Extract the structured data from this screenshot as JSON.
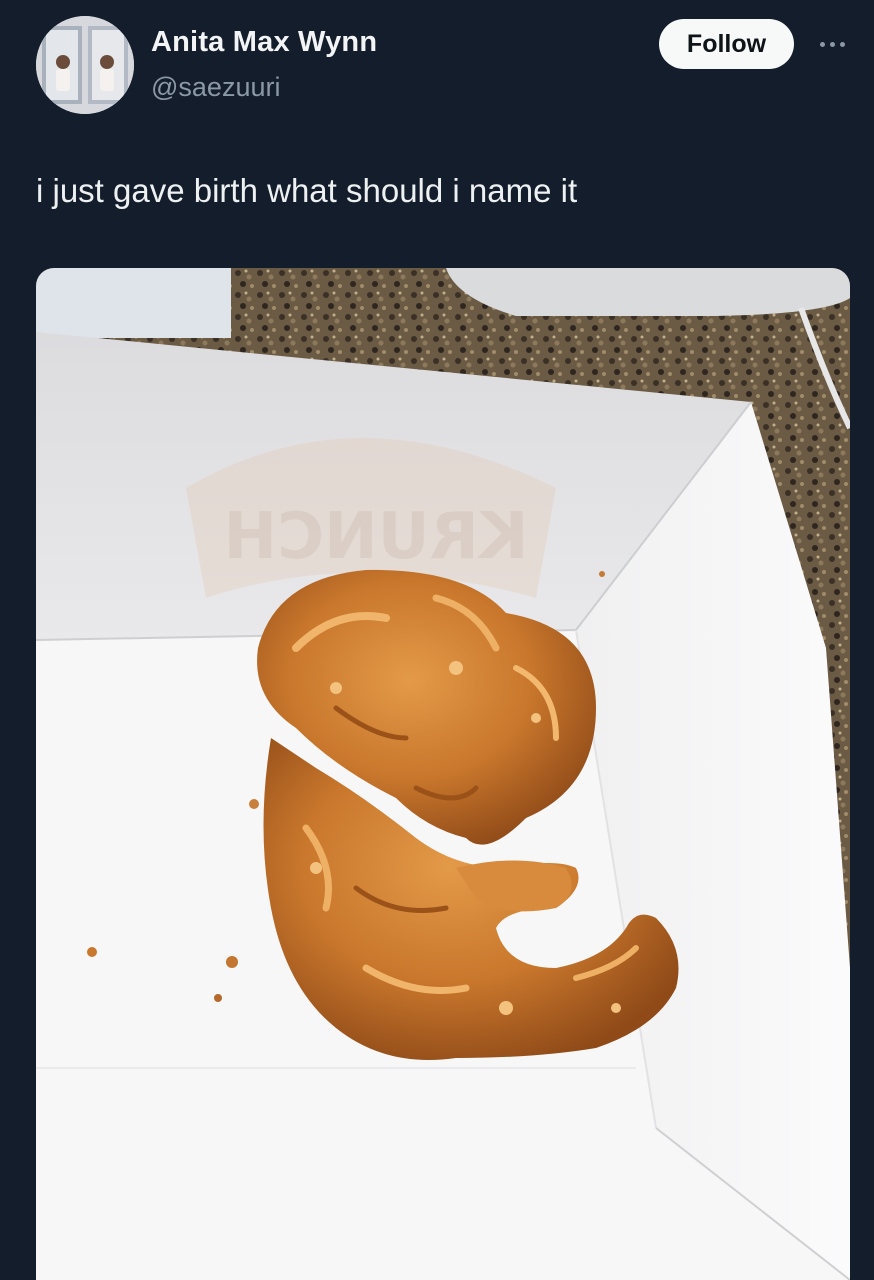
{
  "post": {
    "author": {
      "display_name": "Anita Max Wynn",
      "handle": "@saezuuri"
    },
    "follow_label": "Follow",
    "text": "i just gave birth what should i name it",
    "media": {
      "box_print": "KRUNCH"
    }
  },
  "icons": {
    "more": "more-horizontal-icon"
  },
  "colors": {
    "background": "#141d2b",
    "handle": "#8b98a5",
    "follow_button": "#f7f9f9"
  }
}
